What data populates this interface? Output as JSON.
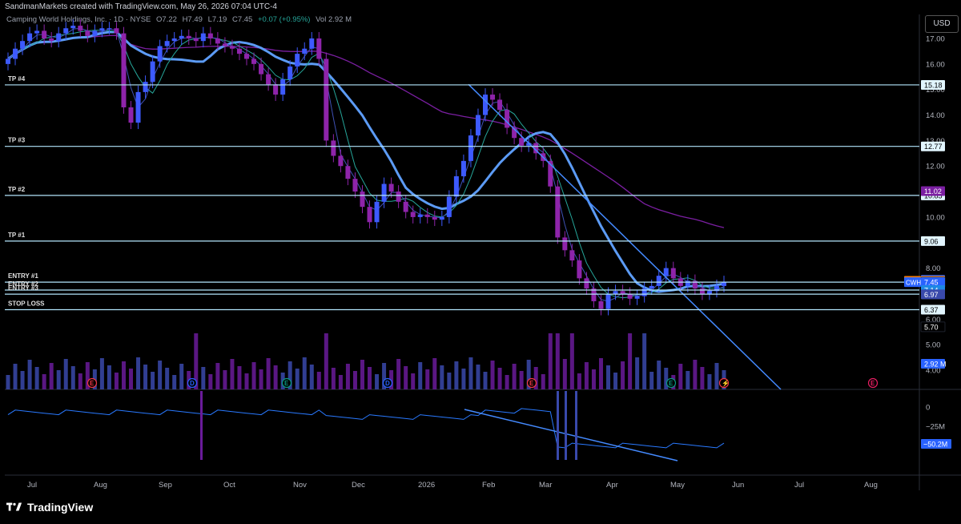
{
  "header": {
    "caption": "SandmanMarkets created with TradingView.com, May 26, 2026 07:04 UTC-4"
  },
  "legend": {
    "symbol": "Camping World Holdings, Inc. · 1D · NYSE",
    "open": "O7.22",
    "high": "H7.49",
    "low": "L7.19",
    "close": "C7.45",
    "change": "+0.07 (+0.95%)",
    "volume": "Vol 2.92 M"
  },
  "currency_button": "USD",
  "brand": "TradingView",
  "chart_data": {
    "type": "candlestick",
    "price_axis_ticks": [
      17.0,
      16.0,
      15.0,
      14.0,
      13.0,
      12.0,
      11.0,
      10.0,
      9.0,
      8.0,
      7.0,
      6.0,
      5.0,
      4.0
    ],
    "price_axis_labels": [
      "17.00",
      "16.00",
      "15.00",
      "14.00",
      "13.00",
      "12.00",
      "11.00",
      "10.00",
      "9.00",
      "8.00",
      "7.00",
      "6.00",
      "5.00",
      "4.00"
    ],
    "time_axis_labels": [
      "Jul",
      "Aug",
      "Sep",
      "Oct",
      "Nov",
      "Dec",
      "2026",
      "Feb",
      "Mar",
      "Apr",
      "May",
      "Jun",
      "Jul",
      "Aug"
    ],
    "ylim": [
      4.0,
      17.6
    ],
    "levels": [
      {
        "label": "TP #4",
        "price": 15.18,
        "tag": "15.18"
      },
      {
        "label": "TP #3",
        "price": 12.77,
        "tag": "12.77"
      },
      {
        "label": "TP #2",
        "price": 10.85,
        "tag": "10.85"
      },
      {
        "label": "TP #1",
        "price": 9.06,
        "tag": "9.06"
      },
      {
        "label": "ENTRY #1",
        "price": 7.45,
        "tag": "7.45"
      },
      {
        "label": "ENTRY #2",
        "price": 7.14,
        "tag": "7.14"
      },
      {
        "label": "ENTRY #3",
        "price": 6.98,
        "tag": "6.98"
      },
      {
        "label": "STOP LOSS",
        "price": 6.37,
        "tag": "6.37"
      }
    ],
    "axis_tags": [
      {
        "text": "11.02",
        "price": 11.02,
        "color": "#7b1fa2"
      },
      {
        "text": "7.54",
        "price": 7.54,
        "color": "#2962ff"
      },
      {
        "text": "7.50",
        "price": 7.5,
        "color": "#f57c00",
        "prefix": "Pre"
      },
      {
        "text": "7.45",
        "price": 7.45,
        "color": "#000000",
        "outline": "#1e222d"
      },
      {
        "text": "7.45",
        "price": 7.45,
        "color": "#2962ff",
        "prefix": "CWH"
      },
      {
        "text": "7.14",
        "price": 7.14,
        "color": "#1e88e5"
      },
      {
        "text": "6.97",
        "price": 6.97,
        "color": "#3949ab"
      },
      {
        "text": "5.70",
        "price": 5.7,
        "color": "#000000",
        "outline": "#1e222d"
      },
      {
        "text": "2.92 M",
        "price": 4.25,
        "color": "#2962ff"
      }
    ],
    "events": [
      {
        "letter": "E",
        "x": 115,
        "color": "#f23645"
      },
      {
        "letter": "D",
        "x": 240,
        "color": "#2962ff"
      },
      {
        "letter": "E",
        "x": 358,
        "color": "#089981"
      },
      {
        "letter": "D",
        "x": 484,
        "color": "#2962ff"
      },
      {
        "letter": "E",
        "x": 664,
        "color": "#f23645"
      },
      {
        "letter": "E",
        "x": 838,
        "color": "#089981"
      },
      {
        "letter": "⚡",
        "x": 904,
        "color": "#f23645"
      },
      {
        "letter": "E",
        "x": 1090,
        "color": "#e91e63"
      }
    ],
    "oscillator": {
      "ticks": [
        "0",
        "−25M"
      ],
      "value_tag": "−50.2M"
    },
    "series": [
      {
        "name": "close",
        "values": [
          16.2,
          16.6,
          16.9,
          17.2,
          17.3,
          17.0,
          16.9,
          17.2,
          17.4,
          17.5,
          17.3,
          17.1,
          17.3,
          17.4,
          17.4,
          17.2,
          14.3,
          13.7,
          14.9,
          15.3,
          16.1,
          16.7,
          16.9,
          17.0,
          17.1,
          17.0,
          16.9,
          17.2,
          17.0,
          16.8,
          16.7,
          16.6,
          16.4,
          16.2,
          16.0,
          15.6,
          15.2,
          14.8,
          15.4,
          15.9,
          16.4,
          16.6,
          17.0,
          16.2,
          13.0,
          12.4,
          12.0,
          11.5,
          11.0,
          10.4,
          9.8,
          10.6,
          11.3,
          11.0,
          10.6,
          10.2,
          10.0,
          10.1,
          10.0,
          9.9,
          10.0,
          10.8,
          11.6,
          12.2,
          13.2,
          14.0,
          14.8,
          14.6,
          14.2,
          13.5,
          13.1,
          12.8,
          12.9,
          12.5,
          12.2,
          11.2,
          9.2,
          8.7,
          8.3,
          7.6,
          7.2,
          6.7,
          6.4,
          7.0,
          7.1,
          7.0,
          6.8,
          6.9,
          7.2,
          7.3,
          7.7,
          8.0,
          7.6,
          7.3,
          7.5,
          7.2,
          7.0,
          7.1,
          7.3,
          7.45
        ]
      }
    ]
  }
}
